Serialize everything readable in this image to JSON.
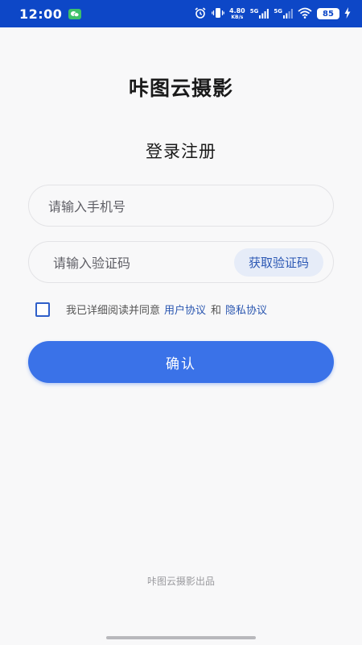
{
  "status_bar": {
    "time": "12:00",
    "net_speed_value": "4.80",
    "net_speed_unit": "KB/s",
    "sim1": "5G",
    "sim2": "5G",
    "battery": "85",
    "background_color": "#0d47c7"
  },
  "app": {
    "title": "咔图云摄影",
    "subtitle": "登录注册"
  },
  "form": {
    "phone_placeholder": "请输入手机号",
    "code_placeholder": "请输入验证码",
    "get_code_label": "获取验证码"
  },
  "agreement": {
    "checked": false,
    "prefix": "我已详细阅读并同意",
    "user_agreement": "用户协议",
    "and": "和",
    "privacy_agreement": "隐私协议"
  },
  "confirm_label": "确认",
  "footer": "咔图云摄影出品",
  "colors": {
    "accent": "#3a72e8",
    "link": "#2a56b0"
  },
  "icons": [
    "wechat-icon",
    "alarm-icon",
    "vibrate-icon",
    "signal-icon",
    "wifi-icon",
    "battery-icon",
    "charging-icon"
  ]
}
